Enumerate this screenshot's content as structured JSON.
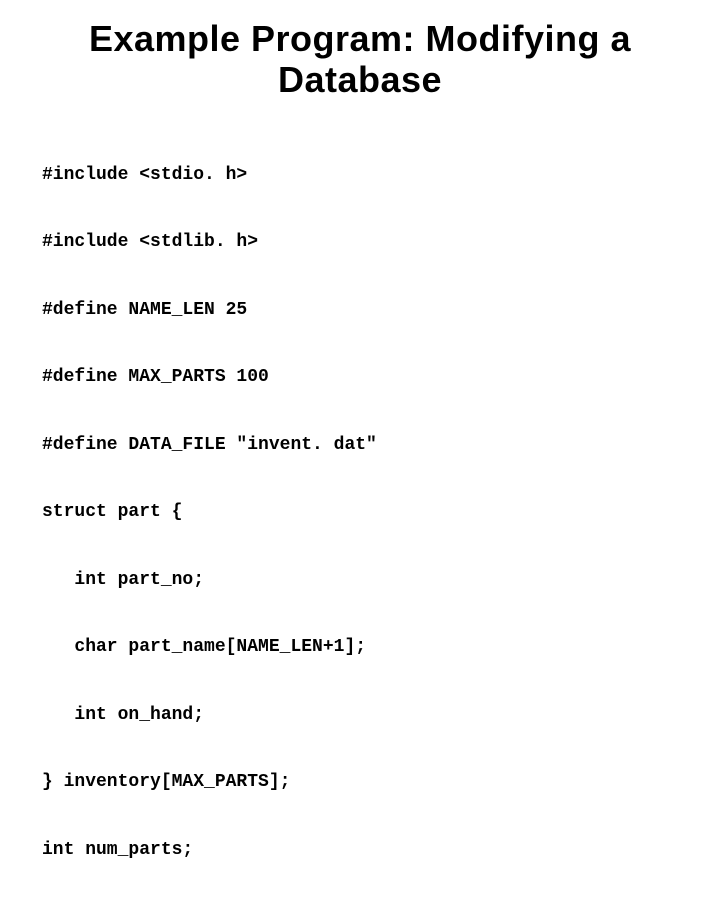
{
  "title": "Example Program: Modifying a Database",
  "code_lines": [
    "#include <stdio. h>",
    "#include <stdlib. h>",
    "#define NAME_LEN 25",
    "#define MAX_PARTS 100",
    "#define DATA_FILE \"invent. dat\"",
    "struct part {",
    "   int part_no;",
    "   char part_name[NAME_LEN+1];",
    "   int on_hand;",
    "} inventory[MAX_PARTS];",
    "int num_parts;"
  ]
}
